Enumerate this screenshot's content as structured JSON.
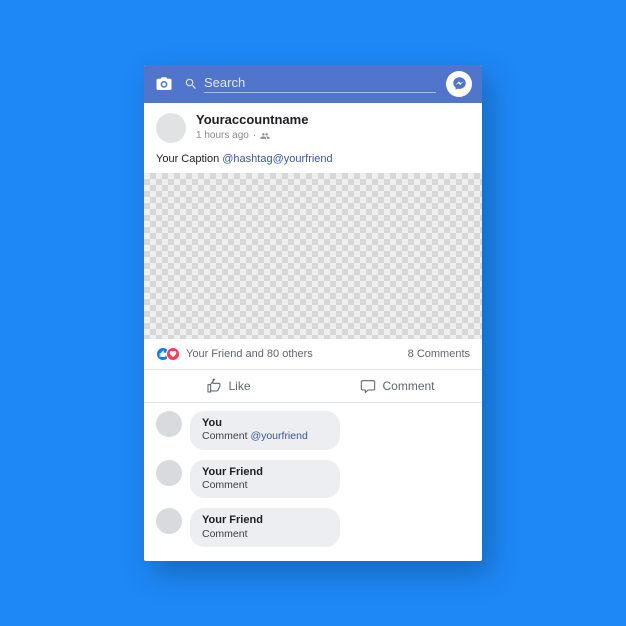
{
  "header": {
    "search_placeholder": "Search"
  },
  "post": {
    "account_name": "Youraccountname",
    "time": "1 hours ago",
    "separator": "·",
    "caption_plain": "Your Caption ",
    "caption_tag": "@hashtag@yourfriend",
    "reactions_text": "Your Friend and 80 others",
    "comments_count_text": "8 Comments"
  },
  "actions": {
    "like_label": "Like",
    "comment_label": "Comment"
  },
  "comments": [
    {
      "name": "You",
      "text": "Comment ",
      "mention": "@yourfriend"
    },
    {
      "name": "Your Friend",
      "text": "Comment",
      "mention": ""
    },
    {
      "name": "Your Friend",
      "text": "Comment",
      "mention": ""
    }
  ]
}
